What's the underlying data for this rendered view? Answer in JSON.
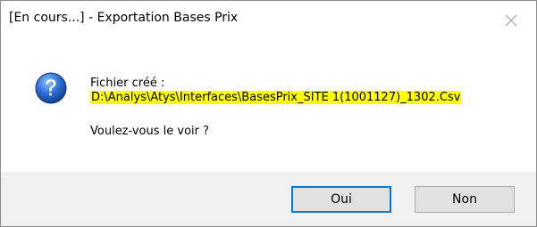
{
  "window": {
    "title": "[En cours...] - Exportation Bases Prix"
  },
  "message": {
    "label": "Fichier créé :",
    "path": "D:\\Analys\\Atys\\Interfaces\\BasesPrix_SITE 1(1001127)_1302.Csv",
    "question": "Voulez-vous le voir ?"
  },
  "buttons": {
    "yes_label": "Oui",
    "no_label": "Non"
  },
  "icons": {
    "close": "close-icon",
    "question": "question-icon"
  },
  "colors": {
    "highlight": "#ffff00",
    "default_button_border": "#0078d7",
    "footer_bg": "#f0f0f0"
  }
}
